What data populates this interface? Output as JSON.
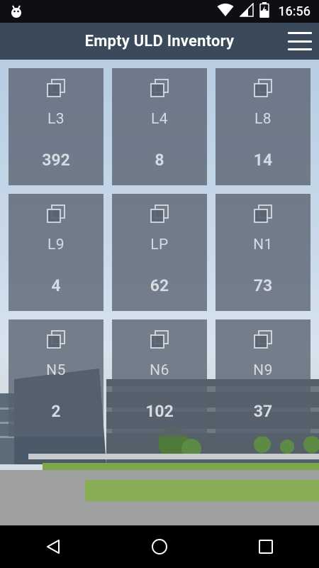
{
  "status_bar": {
    "time": "16:56",
    "icons": [
      "android-debug-icon",
      "wifi-icon",
      "signal-icon",
      "battery-charging-icon"
    ]
  },
  "app_bar": {
    "title": "Empty ULD Inventory",
    "menu_icon": "hamburger-menu-icon"
  },
  "tiles": [
    {
      "code": "L3",
      "count": "392"
    },
    {
      "code": "L4",
      "count": "8"
    },
    {
      "code": "L8",
      "count": "14"
    },
    {
      "code": "L9",
      "count": "4"
    },
    {
      "code": "LP",
      "count": "62"
    },
    {
      "code": "N1",
      "count": "73"
    },
    {
      "code": "N5",
      "count": "2"
    },
    {
      "code": "N6",
      "count": "102"
    },
    {
      "code": "N9",
      "count": "37"
    }
  ],
  "tile_icon": "copy-stack-icon",
  "nav_bar": {
    "icons": [
      "back-icon",
      "home-icon",
      "recents-icon"
    ]
  },
  "colors": {
    "app_bar": "#3a4a5a",
    "tile": "#586270",
    "tile_text": "#d7dbe0"
  }
}
